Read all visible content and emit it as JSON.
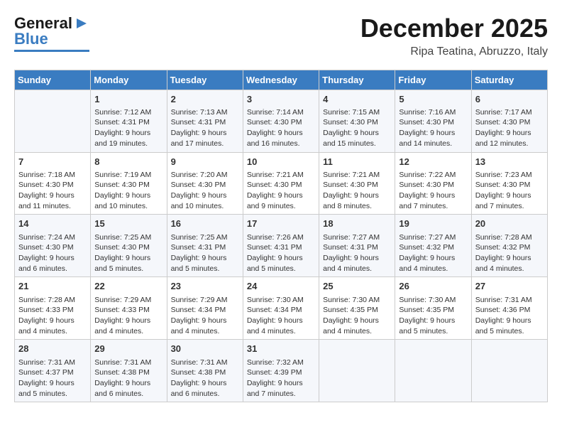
{
  "header": {
    "logo_general": "General",
    "logo_blue": "Blue",
    "title": "December 2025",
    "subtitle": "Ripa Teatina, Abruzzo, Italy"
  },
  "days": [
    "Sunday",
    "Monday",
    "Tuesday",
    "Wednesday",
    "Thursday",
    "Friday",
    "Saturday"
  ],
  "weeks": [
    [
      {
        "date": "",
        "sunrise": "",
        "sunset": "",
        "daylight": ""
      },
      {
        "date": "1",
        "sunrise": "7:12 AM",
        "sunset": "4:31 PM",
        "daylight": "9 hours and 19 minutes."
      },
      {
        "date": "2",
        "sunrise": "7:13 AM",
        "sunset": "4:31 PM",
        "daylight": "9 hours and 17 minutes."
      },
      {
        "date": "3",
        "sunrise": "7:14 AM",
        "sunset": "4:30 PM",
        "daylight": "9 hours and 16 minutes."
      },
      {
        "date": "4",
        "sunrise": "7:15 AM",
        "sunset": "4:30 PM",
        "daylight": "9 hours and 15 minutes."
      },
      {
        "date": "5",
        "sunrise": "7:16 AM",
        "sunset": "4:30 PM",
        "daylight": "9 hours and 14 minutes."
      },
      {
        "date": "6",
        "sunrise": "7:17 AM",
        "sunset": "4:30 PM",
        "daylight": "9 hours and 12 minutes."
      }
    ],
    [
      {
        "date": "7",
        "sunrise": "7:18 AM",
        "sunset": "4:30 PM",
        "daylight": "9 hours and 11 minutes."
      },
      {
        "date": "8",
        "sunrise": "7:19 AM",
        "sunset": "4:30 PM",
        "daylight": "9 hours and 10 minutes."
      },
      {
        "date": "9",
        "sunrise": "7:20 AM",
        "sunset": "4:30 PM",
        "daylight": "9 hours and 10 minutes."
      },
      {
        "date": "10",
        "sunrise": "7:21 AM",
        "sunset": "4:30 PM",
        "daylight": "9 hours and 9 minutes."
      },
      {
        "date": "11",
        "sunrise": "7:21 AM",
        "sunset": "4:30 PM",
        "daylight": "9 hours and 8 minutes."
      },
      {
        "date": "12",
        "sunrise": "7:22 AM",
        "sunset": "4:30 PM",
        "daylight": "9 hours and 7 minutes."
      },
      {
        "date": "13",
        "sunrise": "7:23 AM",
        "sunset": "4:30 PM",
        "daylight": "9 hours and 7 minutes."
      }
    ],
    [
      {
        "date": "14",
        "sunrise": "7:24 AM",
        "sunset": "4:30 PM",
        "daylight": "9 hours and 6 minutes."
      },
      {
        "date": "15",
        "sunrise": "7:25 AM",
        "sunset": "4:30 PM",
        "daylight": "9 hours and 5 minutes."
      },
      {
        "date": "16",
        "sunrise": "7:25 AM",
        "sunset": "4:31 PM",
        "daylight": "9 hours and 5 minutes."
      },
      {
        "date": "17",
        "sunrise": "7:26 AM",
        "sunset": "4:31 PM",
        "daylight": "9 hours and 5 minutes."
      },
      {
        "date": "18",
        "sunrise": "7:27 AM",
        "sunset": "4:31 PM",
        "daylight": "9 hours and 4 minutes."
      },
      {
        "date": "19",
        "sunrise": "7:27 AM",
        "sunset": "4:32 PM",
        "daylight": "9 hours and 4 minutes."
      },
      {
        "date": "20",
        "sunrise": "7:28 AM",
        "sunset": "4:32 PM",
        "daylight": "9 hours and 4 minutes."
      }
    ],
    [
      {
        "date": "21",
        "sunrise": "7:28 AM",
        "sunset": "4:33 PM",
        "daylight": "9 hours and 4 minutes."
      },
      {
        "date": "22",
        "sunrise": "7:29 AM",
        "sunset": "4:33 PM",
        "daylight": "9 hours and 4 minutes."
      },
      {
        "date": "23",
        "sunrise": "7:29 AM",
        "sunset": "4:34 PM",
        "daylight": "9 hours and 4 minutes."
      },
      {
        "date": "24",
        "sunrise": "7:30 AM",
        "sunset": "4:34 PM",
        "daylight": "9 hours and 4 minutes."
      },
      {
        "date": "25",
        "sunrise": "7:30 AM",
        "sunset": "4:35 PM",
        "daylight": "9 hours and 4 minutes."
      },
      {
        "date": "26",
        "sunrise": "7:30 AM",
        "sunset": "4:35 PM",
        "daylight": "9 hours and 5 minutes."
      },
      {
        "date": "27",
        "sunrise": "7:31 AM",
        "sunset": "4:36 PM",
        "daylight": "9 hours and 5 minutes."
      }
    ],
    [
      {
        "date": "28",
        "sunrise": "7:31 AM",
        "sunset": "4:37 PM",
        "daylight": "9 hours and 5 minutes."
      },
      {
        "date": "29",
        "sunrise": "7:31 AM",
        "sunset": "4:38 PM",
        "daylight": "9 hours and 6 minutes."
      },
      {
        "date": "30",
        "sunrise": "7:31 AM",
        "sunset": "4:38 PM",
        "daylight": "9 hours and 6 minutes."
      },
      {
        "date": "31",
        "sunrise": "7:32 AM",
        "sunset": "4:39 PM",
        "daylight": "9 hours and 7 minutes."
      },
      {
        "date": "",
        "sunrise": "",
        "sunset": "",
        "daylight": ""
      },
      {
        "date": "",
        "sunrise": "",
        "sunset": "",
        "daylight": ""
      },
      {
        "date": "",
        "sunrise": "",
        "sunset": "",
        "daylight": ""
      }
    ]
  ],
  "labels": {
    "sunrise_prefix": "Sunrise: ",
    "sunset_prefix": "Sunset: ",
    "daylight_prefix": "Daylight: "
  }
}
